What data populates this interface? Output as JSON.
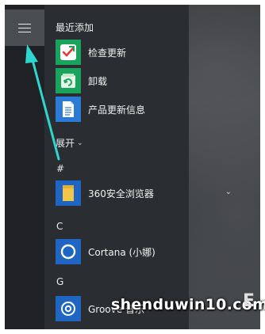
{
  "menu": {
    "recent_header": "最近添加",
    "expand_label": "展开",
    "recent_items": [
      {
        "label": "检查更新",
        "icon": "check-update-icon",
        "color": "#1aa35c"
      },
      {
        "label": "卸载",
        "icon": "uninstall-icon",
        "color": "#1aa35c"
      },
      {
        "label": "产品更新信息",
        "icon": "document-icon",
        "color": "#2b7bd6"
      }
    ],
    "groups": [
      {
        "letter": "#",
        "item": {
          "label": "360安全浏览器",
          "icon": "folder-icon",
          "color": "#1e66c2",
          "expandable": true
        }
      },
      {
        "letter": "C",
        "item": {
          "label": "Cortana (小娜)",
          "icon": "cortana-icon",
          "color": "#1e66c2"
        }
      },
      {
        "letter": "G",
        "item": {
          "label": "Groove 音乐",
          "icon": "groove-music-icon",
          "color": "#1e66c2"
        }
      }
    ]
  },
  "watermark": {
    "text": "shenduwin10.com",
    "trailing": "E"
  }
}
